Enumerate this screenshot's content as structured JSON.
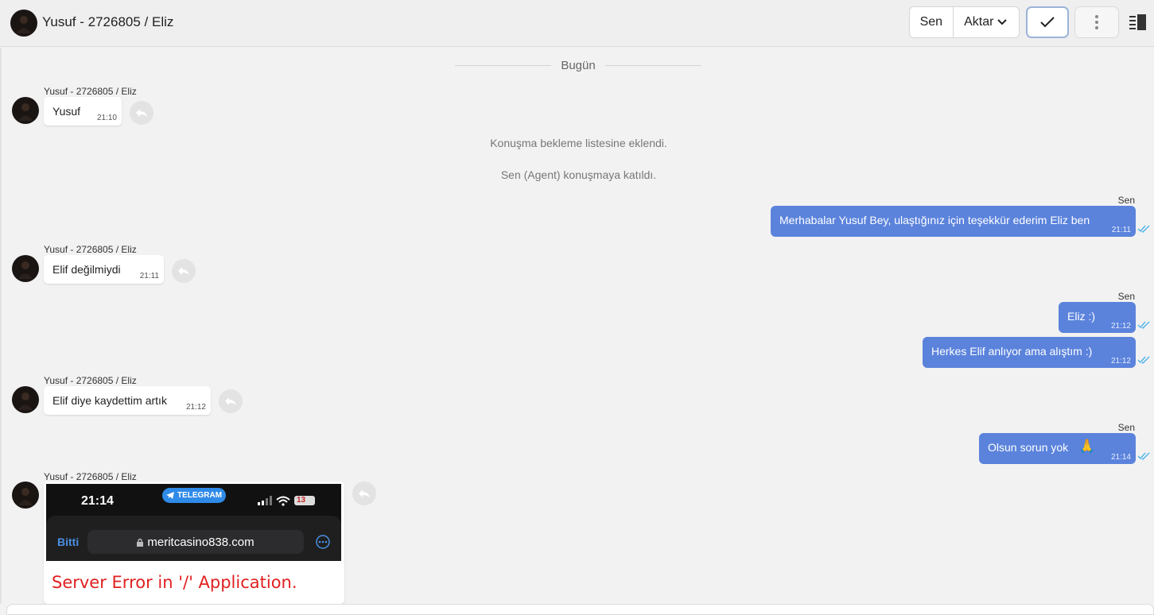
{
  "header": {
    "title": "Yusuf - 2726805 / Eliz",
    "assign_label": "Sen",
    "transfer_label": "Aktar",
    "resolve_icon": "check-icon",
    "more_icon": "vertical-dots-icon",
    "panel_icon": "side-panel-icon"
  },
  "chat": {
    "date_divider": "Bugün",
    "contact_name": "Yusuf - 2726805 / Eliz",
    "agent_label": "Sen",
    "system_messages": [
      "Konuşma bekleme listesine eklendi.",
      "Sen (Agent) konuşmaya katıldı."
    ],
    "messages": [
      {
        "direction": "in",
        "text": "Yusuf",
        "time": "21:10"
      },
      {
        "direction": "out",
        "text": "Merhabalar Yusuf Bey, ulaştığınız için teşekkür ederim Eliz ben",
        "time": "21:11"
      },
      {
        "direction": "in",
        "text": "Elif değilmiydi",
        "time": "21:11"
      },
      {
        "direction": "out",
        "text": "Eliz :)",
        "time": "21:12"
      },
      {
        "direction": "out",
        "text": "Herkes Elif anlıyor ama alıştım :)",
        "time": "21:12"
      },
      {
        "direction": "in",
        "text": "Elif diye kaydettim artık",
        "time": "21:12"
      },
      {
        "direction": "out",
        "text": "Olsun sorun yok",
        "emoji": "🙏",
        "time": "21:14"
      }
    ],
    "image_message": {
      "phone_time": "21:14",
      "app_badge": "TELEGRAM",
      "battery": "13",
      "done_label": "Bitti",
      "url": "meritcasino838.com",
      "error_text": "Server Error in '/' Application."
    }
  },
  "colors": {
    "accent": "#5b83dc",
    "read_ticks": "#4fb3e8",
    "error_red": "#e02020"
  }
}
